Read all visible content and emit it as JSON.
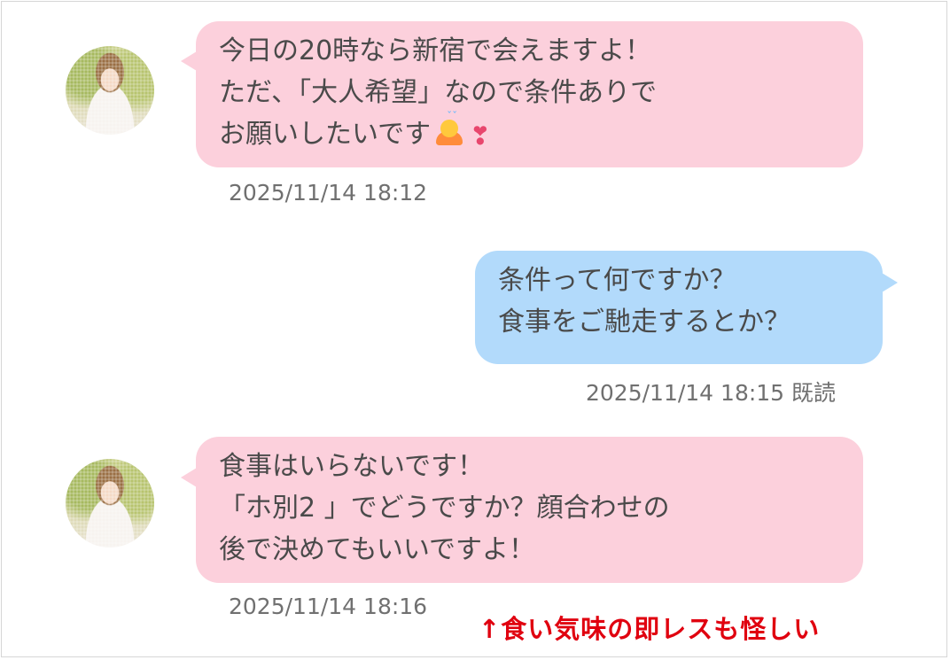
{
  "messages": [
    {
      "side": "received",
      "avatar": "profile-photo",
      "lines": [
        "今日の20時なら新宿で会えますよ！",
        "ただ、「大人希望」なので条件ありで",
        "お願いしたいです"
      ],
      "emoji": [
        "person-bowing-icon",
        "heart-exclamation-icon"
      ],
      "timestamp": "2025/11/14 18:12"
    },
    {
      "side": "sent",
      "lines": [
        "条件って何ですか？",
        "食事をご馳走するとか？"
      ],
      "timestamp": "2025/11/14 18:15 既読"
    },
    {
      "side": "received",
      "avatar": "profile-photo",
      "lines": [
        "食事はいらないです！",
        "「ホ別2 」でどうですか？顔合わせの",
        "後で決めてもいいですよ！"
      ],
      "timestamp": "2025/11/14 18:16"
    }
  ],
  "annotation": "↑食い気味の即レスも怪しい",
  "colors": {
    "received_bubble": "#fcd0dc",
    "sent_bubble": "#b2dafb",
    "text": "#4a4a4a",
    "timestamp": "#707070",
    "annotation": "#e0000f"
  }
}
